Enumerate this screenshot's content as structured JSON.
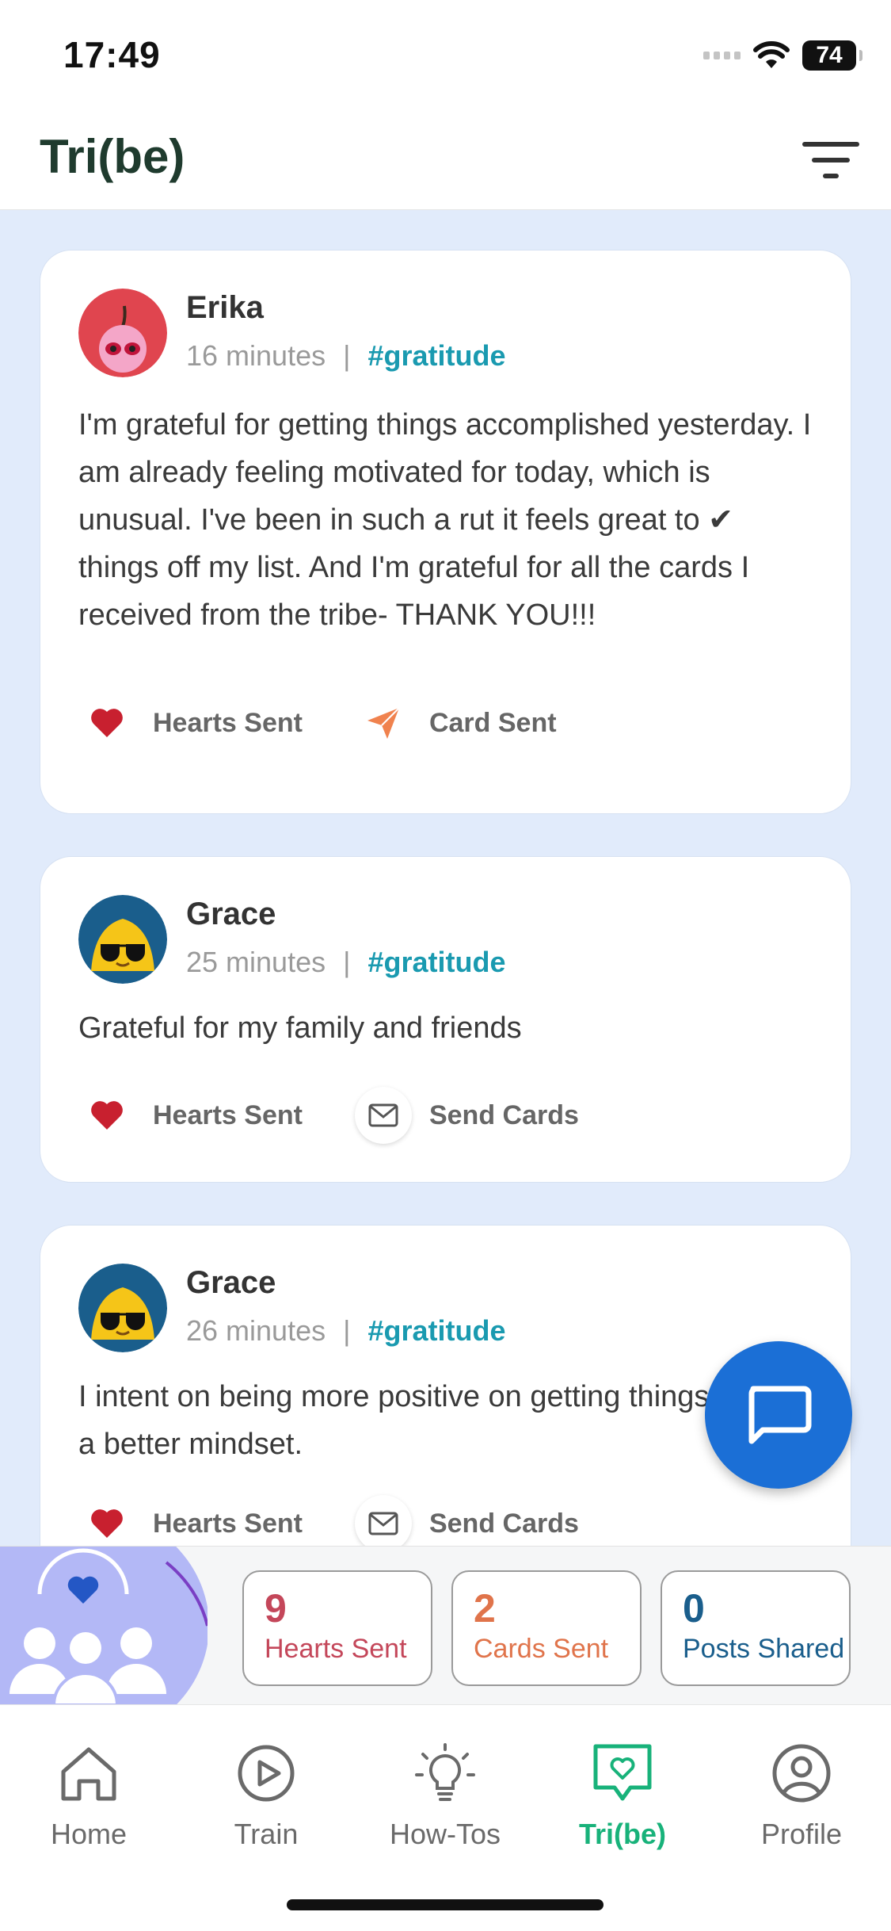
{
  "status_bar": {
    "time": "17:49",
    "battery": "74"
  },
  "header": {
    "title": "Tri(be)",
    "filter_icon": "filter-icon"
  },
  "posts": [
    {
      "author": "Erika",
      "time": "16 minutes",
      "tag": "#gratitude",
      "text": "I'm grateful for getting things accomplished yesterday. I am already feeling motivated for today, which is unusual. I've been in such a rut it feels great to ✔ things off my list. And I'm grateful for all the cards I received from the tribe- THANK YOU!!!",
      "hearts_label": "Hearts Sent",
      "card_label": "Card Sent"
    },
    {
      "author": "Grace",
      "time": "25 minutes",
      "tag": "#gratitude",
      "text": "Grateful for my family and friends",
      "hearts_label": "Hearts Sent",
      "card_label": "Send Cards"
    },
    {
      "author": "Grace",
      "time": "26 minutes",
      "tag": "#gratitude",
      "text": "I intent on being more positive on getting things done to a better mindset.",
      "hearts_label": "Hearts Sent",
      "card_label": "Send Cards"
    }
  ],
  "stats": [
    {
      "value": "9",
      "label": "Hearts Sent",
      "color": "#c4475a"
    },
    {
      "value": "2",
      "label": "Cards Sent",
      "color": "#e0744b"
    },
    {
      "value": "0",
      "label": "Posts Shared",
      "color": "#1a5e8c"
    }
  ],
  "nav": [
    {
      "label": "Home",
      "icon": "home-icon"
    },
    {
      "label": "Train",
      "icon": "play-icon"
    },
    {
      "label": "How-Tos",
      "icon": "lightbulb-icon"
    },
    {
      "label": "Tri(be)",
      "icon": "heart-chat-icon",
      "active": true
    },
    {
      "label": "Profile",
      "icon": "profile-icon"
    }
  ],
  "colors": {
    "accent": "#18b27a",
    "fab": "#1b6fd6",
    "tag": "#1a9ab0",
    "feed_bg": "#e1ebfb"
  }
}
